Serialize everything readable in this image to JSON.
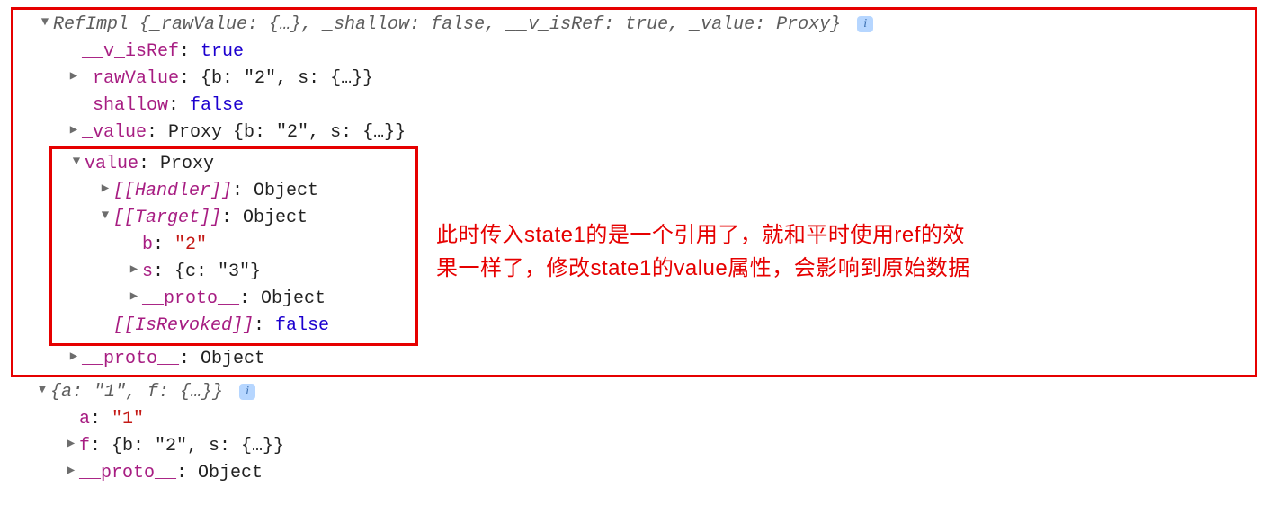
{
  "refimpl": {
    "summary_prefix": "RefImpl ",
    "summary_inner": "{_rawValue: {…}, _shallow: false, __v_isRef: true, _value: Proxy}",
    "info_badge": "i",
    "v_isRef": {
      "key": "__v_isRef",
      "value": "true"
    },
    "rawValue": {
      "key": "_rawValue",
      "summary": "{b: \"2\", s: {…}}"
    },
    "shallow": {
      "key": "_shallow",
      "value": "false"
    },
    "valueUnderscore": {
      "key": "_value",
      "type": "Proxy ",
      "summary": "{b: \"2\", s: {…}}"
    },
    "valueBlock": {
      "key": "value",
      "type": "Proxy",
      "handler": {
        "key": "[[Handler]]",
        "value": "Object"
      },
      "target": {
        "key": "[[Target]]",
        "value": "Object",
        "b": {
          "key": "b",
          "value": "\"2\""
        },
        "s": {
          "key": "s",
          "value": "{c: \"3\"}"
        },
        "proto": {
          "key": "__proto__",
          "value": "Object"
        }
      },
      "isRevoked": {
        "key": "[[IsRevoked]]",
        "value": "false"
      }
    },
    "proto": {
      "key": "__proto__",
      "value": "Object"
    }
  },
  "below": {
    "summary": "{a: \"1\", f: {…}}",
    "info_badge": "i",
    "a": {
      "key": "a",
      "value": "\"1\""
    },
    "f": {
      "key": "f",
      "value": "{b: \"2\", s: {…}}"
    },
    "proto": {
      "key": "__proto__",
      "value": "Object"
    }
  },
  "annotation": "此时传入state1的是一个引用了，就和平时使用ref的效果一样了，修改state1的value属性，会影响到原始数据"
}
